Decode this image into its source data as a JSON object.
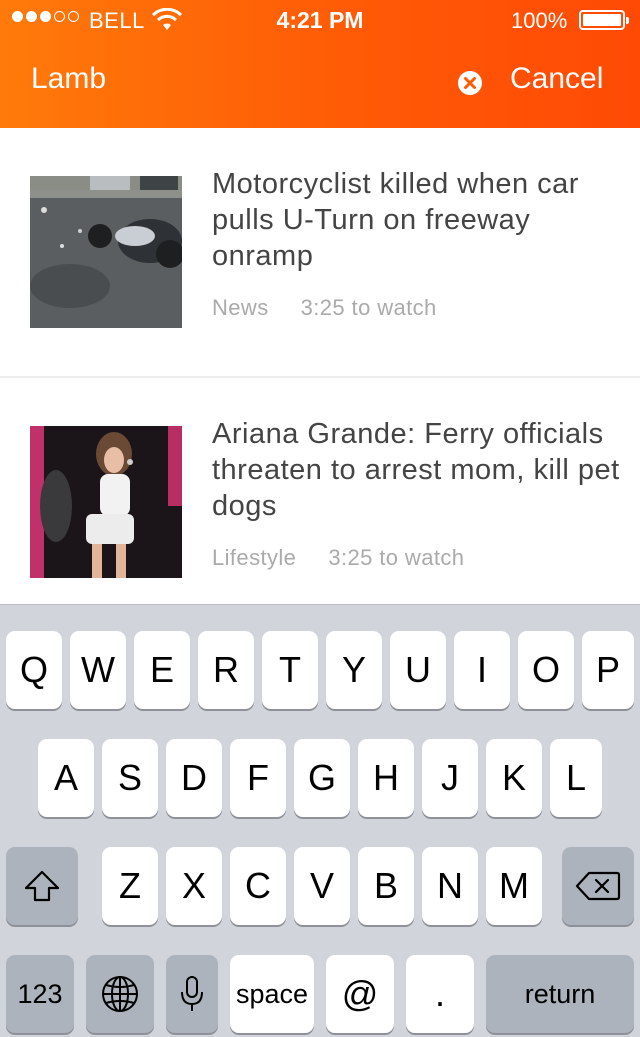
{
  "status_bar": {
    "carrier": "BELL",
    "time": "4:21 PM",
    "battery": "100%"
  },
  "header": {
    "search_text": "Lamb",
    "cancel_label": "Cancel",
    "accent_color": "#ff5a06"
  },
  "results": [
    {
      "title": "Motorcyclist killed when car pulls U-Turn on freeway onramp",
      "category": "News",
      "duration": "3:25 to watch"
    },
    {
      "title": "Ariana Grande: Ferry officials threaten to arrest mom, kill pet dogs",
      "category": "Lifestyle",
      "duration": "3:25 to watch"
    }
  ],
  "keyboard": {
    "row1": [
      "Q",
      "W",
      "E",
      "R",
      "T",
      "Y",
      "U",
      "I",
      "O",
      "P"
    ],
    "row2": [
      "A",
      "S",
      "D",
      "F",
      "G",
      "H",
      "J",
      "K",
      "L"
    ],
    "row3": [
      "Z",
      "X",
      "C",
      "V",
      "B",
      "N",
      "M"
    ],
    "numbers_label": "123",
    "space_label": "space",
    "at_label": "@",
    "period_label": ".",
    "return_label": "return"
  }
}
